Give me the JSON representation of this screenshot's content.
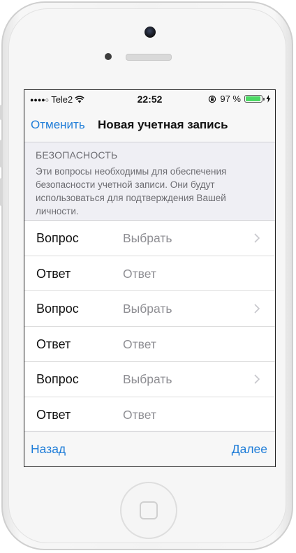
{
  "status_bar": {
    "carrier": "Tele2",
    "time": "22:52",
    "battery_percent": "97 %",
    "battery_level": 0.97,
    "icons": [
      "signal-dots-icon",
      "wifi-icon",
      "orientation-lock-icon",
      "battery-icon",
      "charging-bolt-icon"
    ]
  },
  "nav": {
    "cancel_label": "Отменить",
    "title": "Новая учетная запись"
  },
  "security": {
    "header": "БЕЗОПАСНОСТЬ",
    "description": "Эти вопросы необходимы для обеспечения безопасности учетной записи. Они будут использоваться для подтверждения Вашей личности."
  },
  "rows": [
    {
      "label": "Вопрос",
      "value": "Выбрать",
      "chevron": true
    },
    {
      "label": "Ответ",
      "value": "Ответ",
      "chevron": false
    },
    {
      "label": "Вопрос",
      "value": "Выбрать",
      "chevron": true
    },
    {
      "label": "Ответ",
      "value": "Ответ",
      "chevron": false
    },
    {
      "label": "Вопрос",
      "value": "Выбрать",
      "chevron": true
    },
    {
      "label": "Ответ",
      "value": "Ответ",
      "chevron": false
    }
  ],
  "toolbar": {
    "back_label": "Назад",
    "next_label": "Далее"
  },
  "colors": {
    "accent": "#1f7dd8",
    "battery": "#4cd964",
    "section_bg": "#efeff4"
  }
}
